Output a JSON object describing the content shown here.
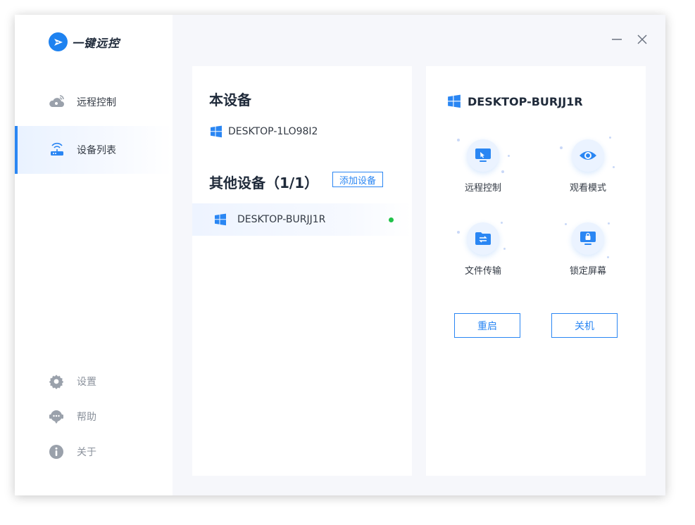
{
  "app": {
    "title": "一键远控"
  },
  "sidebar": {
    "nav": [
      {
        "label": "远程控制",
        "icon": "cloud-remote-icon",
        "active": false
      },
      {
        "label": "设备列表",
        "icon": "router-icon",
        "active": true
      }
    ],
    "bottom": [
      {
        "label": "设置",
        "icon": "gear-icon"
      },
      {
        "label": "帮助",
        "icon": "help-chat-icon"
      },
      {
        "label": "关于",
        "icon": "info-icon"
      }
    ]
  },
  "window_controls": {
    "minimize": "minimize-icon",
    "close": "close-icon"
  },
  "local_device": {
    "title": "本设备",
    "name": "DESKTOP-1LO98I2"
  },
  "other_devices": {
    "title": "其他设备（1/1）",
    "add_button": "添加设备",
    "items": [
      {
        "name": "DESKTOP-BURJJ1R",
        "status": "online"
      }
    ]
  },
  "selected_device": {
    "name": "DESKTOP-BURJJ1R",
    "actions": [
      {
        "label": "远程控制",
        "icon": "remote-desktop-icon"
      },
      {
        "label": "观看模式",
        "icon": "eye-icon"
      },
      {
        "label": "文件传输",
        "icon": "folder-transfer-icon"
      },
      {
        "label": "锁定屏幕",
        "icon": "lock-screen-icon"
      }
    ],
    "restart_button": "重启",
    "shutdown_button": "关机"
  },
  "colors": {
    "accent": "#2a86f3",
    "online": "#21c24a",
    "text_dark": "#1f2a3a",
    "text_muted": "#8b929c"
  }
}
